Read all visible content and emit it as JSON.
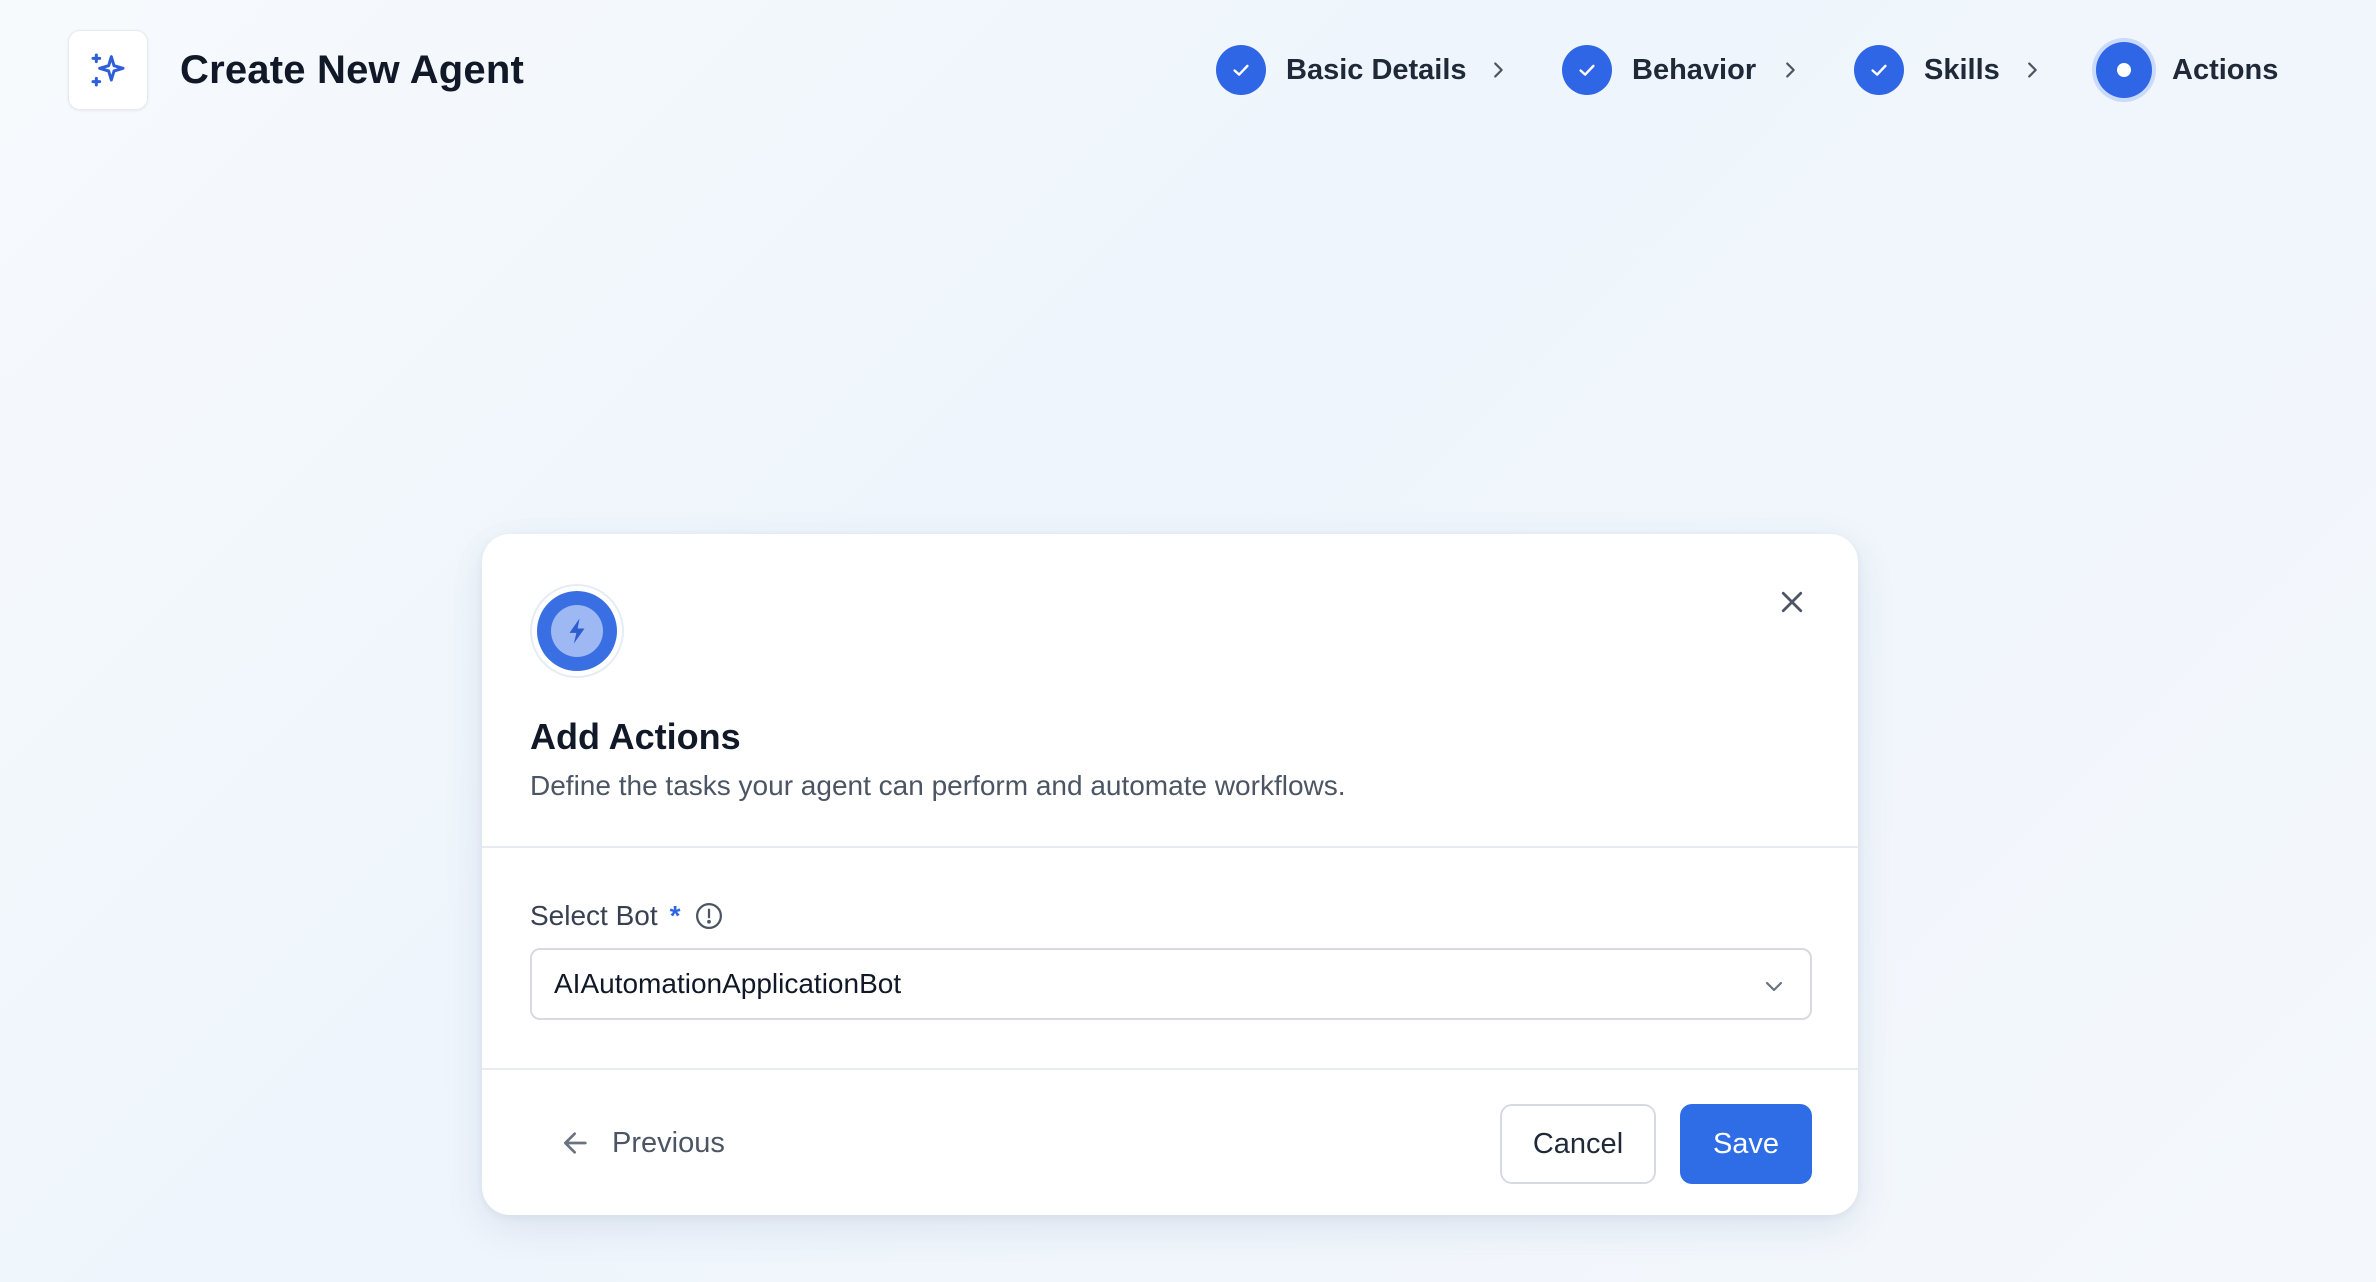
{
  "header": {
    "title": "Create New Agent",
    "logo_icon": "sparkles-icon"
  },
  "stepper": {
    "steps": [
      {
        "label": "Basic Details",
        "status": "completed"
      },
      {
        "label": "Behavior",
        "status": "completed"
      },
      {
        "label": "Skills",
        "status": "completed"
      },
      {
        "label": "Actions",
        "status": "current"
      }
    ],
    "accent_color": "#2f66e6"
  },
  "modal": {
    "icon": "lightning-bolt-icon",
    "title": "Add Actions",
    "subtitle": "Define the tasks your agent can perform and automate workflows.",
    "field": {
      "label": "Select Bot",
      "required_mark": "*",
      "selected_value": "AIAutomationApplicationBot"
    },
    "footer": {
      "previous_label": "Previous",
      "cancel_label": "Cancel",
      "save_label": "Save"
    }
  }
}
